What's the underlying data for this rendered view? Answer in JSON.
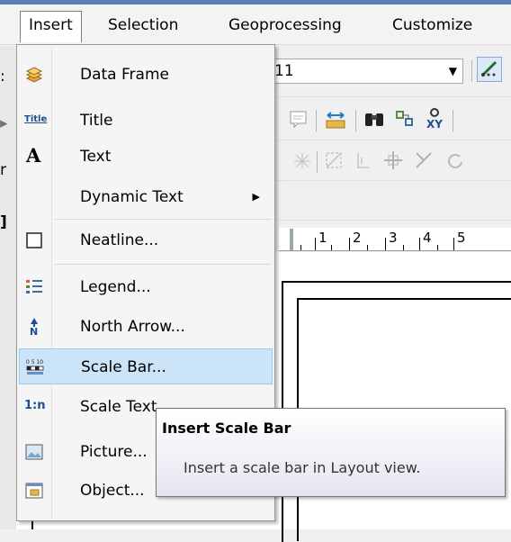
{
  "menubar": {
    "items": [
      "Insert",
      "Selection",
      "Geoprocessing",
      "Customize"
    ],
    "active_index": 0
  },
  "toolbar": {
    "scale_combo_value": "11",
    "left_fragments": [
      "r",
      "r"
    ]
  },
  "ruler": {
    "labels": [
      "1",
      "2",
      "3",
      "4",
      "5"
    ]
  },
  "insert_menu": {
    "items": [
      {
        "label": "Data Frame",
        "icon": "data-frame-icon"
      },
      {
        "label": "Title",
        "icon": "title-icon"
      },
      {
        "label": "Text",
        "icon": "text-icon"
      },
      {
        "label": "Dynamic Text",
        "icon": "",
        "submenu": true
      },
      {
        "label": "Neatline...",
        "icon": "neatline-icon"
      },
      {
        "label": "Legend...",
        "icon": "legend-icon"
      },
      {
        "label": "North Arrow...",
        "icon": "north-arrow-icon"
      },
      {
        "label": "Scale Bar...",
        "icon": "scale-bar-icon",
        "highlighted": true
      },
      {
        "label": "Scale Text...",
        "icon": "scale-text-icon"
      },
      {
        "label": "Picture...",
        "icon": "picture-icon"
      },
      {
        "label": "Object...",
        "icon": "object-icon"
      }
    ],
    "icon_texts": {
      "title": "Title",
      "text": "A",
      "scale_text": "1:n",
      "north": "N"
    }
  },
  "tooltip": {
    "title": "Insert Scale Bar",
    "body": "Insert a scale bar in Layout view."
  },
  "colors": {
    "menu_highlight": "#cce4f7",
    "highlight_border": "#99c9ef",
    "title_strip": "#5b7fb3"
  }
}
